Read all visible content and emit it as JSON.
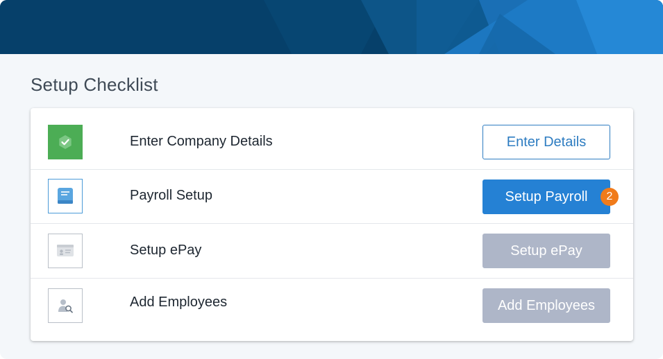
{
  "header": {
    "banner_color": "#06406a",
    "accent_color": "#2581d4"
  },
  "page": {
    "title": "Setup Checklist"
  },
  "checklist": {
    "items": [
      {
        "label": "Enter Company Details",
        "icon": "check-badge-icon",
        "status": "complete",
        "button_label": "Enter Details",
        "button_style": "outline"
      },
      {
        "label": "Payroll Setup",
        "icon": "book-icon",
        "status": "current",
        "button_label": "Setup Payroll",
        "button_style": "primary",
        "badge": "2"
      },
      {
        "label": "Setup ePay",
        "icon": "id-card-icon",
        "status": "pending",
        "button_label": "Setup ePay",
        "button_style": "disabled"
      },
      {
        "label": "Add Employees",
        "icon": "user-search-icon",
        "status": "pending",
        "button_label": "Add Employees",
        "button_style": "disabled"
      }
    ]
  },
  "colors": {
    "complete_green": "#4cad55",
    "primary_blue": "#2581d4",
    "disabled_gray": "#aeb6c8",
    "badge_orange": "#f07b1b"
  }
}
